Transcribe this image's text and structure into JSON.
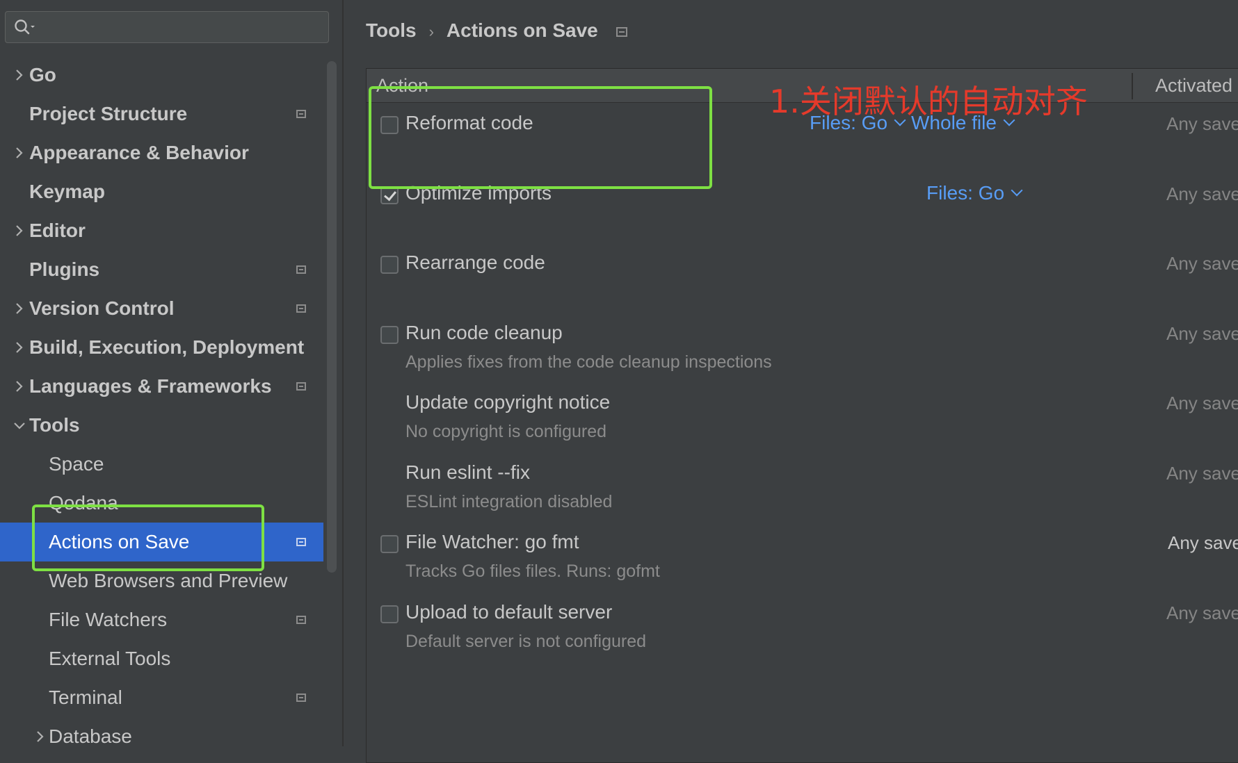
{
  "sidebar": {
    "search_placeholder": "",
    "items": [
      {
        "label": "Go",
        "chevron": "right",
        "level": 0,
        "bold": true,
        "project": false
      },
      {
        "label": "Project Structure",
        "chevron": "",
        "level": 0,
        "bold": true,
        "project": true
      },
      {
        "label": "Appearance & Behavior",
        "chevron": "right",
        "level": 0,
        "bold": true,
        "project": false
      },
      {
        "label": "Keymap",
        "chevron": "",
        "level": 0,
        "bold": true,
        "project": false
      },
      {
        "label": "Editor",
        "chevron": "right",
        "level": 0,
        "bold": true,
        "project": false
      },
      {
        "label": "Plugins",
        "chevron": "",
        "level": 0,
        "bold": true,
        "project": true
      },
      {
        "label": "Version Control",
        "chevron": "right",
        "level": 0,
        "bold": true,
        "project": true
      },
      {
        "label": "Build, Execution, Deployment",
        "chevron": "right",
        "level": 0,
        "bold": true,
        "project": false
      },
      {
        "label": "Languages & Frameworks",
        "chevron": "right",
        "level": 0,
        "bold": true,
        "project": true
      },
      {
        "label": "Tools",
        "chevron": "down",
        "level": 0,
        "bold": true,
        "project": false
      },
      {
        "label": "Space",
        "chevron": "",
        "level": 1,
        "bold": false,
        "project": false
      },
      {
        "label": "Qodana",
        "chevron": "",
        "level": 1,
        "bold": false,
        "project": false
      },
      {
        "label": "Actions on Save",
        "chevron": "",
        "level": 1,
        "bold": false,
        "project": true,
        "selected": true
      },
      {
        "label": "Web Browsers and Preview",
        "chevron": "",
        "level": 1,
        "bold": false,
        "project": false
      },
      {
        "label": "File Watchers",
        "chevron": "",
        "level": 1,
        "bold": false,
        "project": true
      },
      {
        "label": "External Tools",
        "chevron": "",
        "level": 1,
        "bold": false,
        "project": false
      },
      {
        "label": "Terminal",
        "chevron": "",
        "level": 1,
        "bold": false,
        "project": true
      },
      {
        "label": "Database",
        "chevron": "right",
        "level": 1,
        "bold": false,
        "project": false
      }
    ]
  },
  "breadcrumb": {
    "parent": "Tools",
    "separator": "›",
    "current": "Actions on Save"
  },
  "table": {
    "col_action": "Action",
    "col_activated": "Activated On",
    "rows": [
      {
        "title": "Reformat code",
        "checkbox": true,
        "checked": false,
        "desc": "",
        "dropdowns": [
          "Files: Go",
          "Whole file"
        ],
        "activated": "Any save",
        "activated_active": false
      },
      {
        "title": "Optimize imports",
        "checkbox": true,
        "checked": true,
        "desc": "",
        "dropdowns": [
          "Files: Go"
        ],
        "activated": "Any save",
        "activated_active": false
      },
      {
        "title": "Rearrange code",
        "checkbox": true,
        "checked": false,
        "desc": "",
        "dropdowns": [],
        "activated": "Any save",
        "activated_active": false
      },
      {
        "title": "Run code cleanup",
        "checkbox": true,
        "checked": false,
        "desc": "Applies fixes from the code cleanup inspections",
        "dropdowns": [],
        "activated": "Any save",
        "activated_active": false
      },
      {
        "title": "Update copyright notice",
        "checkbox": false,
        "checked": false,
        "desc": "No copyright is configured",
        "dropdowns": [],
        "activated": "Any save",
        "activated_active": false
      },
      {
        "title": "Run eslint --fix",
        "checkbox": false,
        "checked": false,
        "desc": "ESLint integration disabled",
        "dropdowns": [],
        "activated": "Any save",
        "activated_active": false
      },
      {
        "title": "File Watcher: go fmt",
        "checkbox": true,
        "checked": false,
        "desc": "Tracks Go files files. Runs: gofmt",
        "dropdowns": [],
        "activated": "Any save",
        "activated_active": true
      },
      {
        "title": "Upload to default server",
        "checkbox": true,
        "checked": false,
        "desc": "Default server is not configured",
        "dropdowns": [],
        "activated": "Any save",
        "activated_active": false
      }
    ]
  },
  "annotation": {
    "text": "1.关闭默认的自动对齐",
    "color": "#e53a2b"
  },
  "colors": {
    "accent": "#2f65ca",
    "link": "#589df6",
    "highlight": "#7ee043",
    "background": "#3c3f41"
  }
}
